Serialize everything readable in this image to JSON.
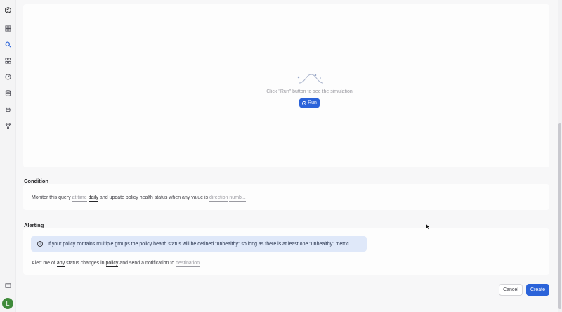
{
  "sidebar": {
    "icons": [
      "logo-icon",
      "dashboard-icon",
      "search-icon",
      "widgets-icon",
      "gauge-icon",
      "database-icon",
      "plug-icon",
      "branch-icon",
      "book-icon"
    ],
    "avatar_initial": "L"
  },
  "simulation": {
    "empty_text": "Click \"Run\" button to see the simulation",
    "run_label": "Run"
  },
  "condition": {
    "title": "Condition",
    "prefix": "Monitor this query",
    "at_time": "at time",
    "frequency": "daily",
    "middle": "and update policy health status when any value is",
    "direction": "direction",
    "number": "numb..."
  },
  "alerting": {
    "title": "Alerting",
    "info": "If your policy contains multiple groups the policy health status will be defined \"unhealthy\" so long as there is at least one \"unhealthy\" metric.",
    "prefix": "Alert me of",
    "any": "any",
    "middle1": "status changes in",
    "policy": "policy",
    "middle2": "and send a notification to",
    "destination": "destination"
  },
  "footer": {
    "cancel_label": "Cancel",
    "create_label": "Create"
  },
  "colors": {
    "accent": "#2b63d9",
    "avatar": "#3f8a3a",
    "info_bg": "#dfe8f9"
  }
}
